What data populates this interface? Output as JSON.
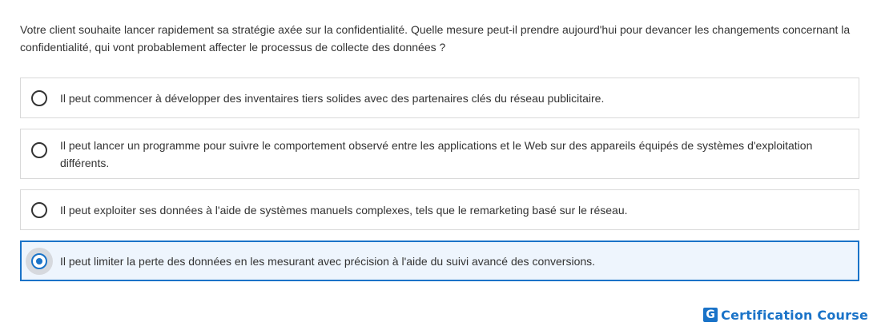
{
  "question": "Votre client souhaite lancer rapidement sa stratégie axée sur la confidentialité. Quelle mesure peut-il prendre aujourd'hui pour devancer les changements concernant la confidentialité, qui vont probablement affecter le processus de collecte des données ?",
  "options": [
    {
      "label": "Il peut commencer à développer des inventaires tiers solides avec des partenaires clés du réseau publicitaire.",
      "selected": false
    },
    {
      "label": "Il peut lancer un programme pour suivre le comportement observé entre les applications et le Web sur des appareils équipés de systèmes d'exploitation différents.",
      "selected": false
    },
    {
      "label": "Il peut exploiter ses données à l'aide de systèmes manuels complexes, tels que le remarketing basé sur le réseau.",
      "selected": false
    },
    {
      "label": "Il peut limiter la perte des données en les mesurant avec précision à l'aide du suivi avancé des conversions.",
      "selected": true
    }
  ],
  "brand": {
    "logo_letter": "G",
    "name": "Certification Course",
    "color": "#1a73c8"
  }
}
